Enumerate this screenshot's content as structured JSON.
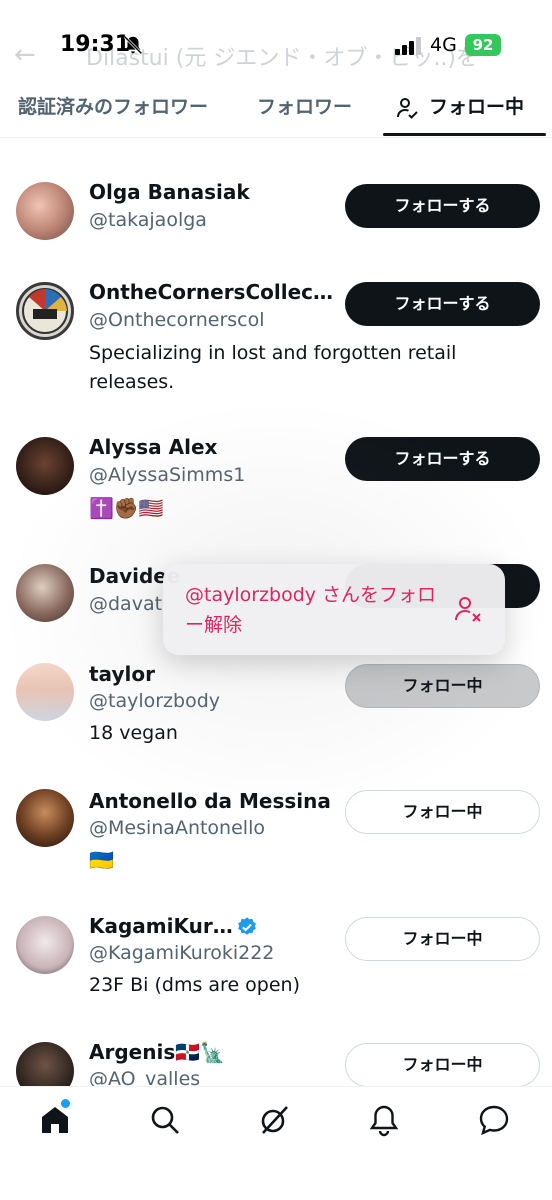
{
  "status": {
    "time": "19:31",
    "network": "4G",
    "battery": "92"
  },
  "header": {
    "back_ghost": "←",
    "title_ghost": "Dilastui (元 ジエンド・オブ・ピッ..)を"
  },
  "tabs": {
    "verified": "認証済みのフォロワー",
    "followers": "フォロワー",
    "following": "フォロー中"
  },
  "users": [
    {
      "name": "Olga Banasiak",
      "handle": "@takajaolga",
      "button": "フォローする"
    },
    {
      "name": "OntheCornersCollecti...",
      "handle": "@Onthecornerscol",
      "bio": "Specializing in lost and forgotten retail releases.",
      "button": "フォローする"
    },
    {
      "name": "Alyssa Alex",
      "handle": "@AlyssaSimms1",
      "bio": "✝️✊🏾🇺🇸",
      "button": "フォローする"
    },
    {
      "name": "Davidee",
      "handle": "@davat"
    },
    {
      "name": "taylor",
      "handle": "@taylorzbody",
      "bio": "18 vegan",
      "button": "フォロー中"
    },
    {
      "name": "Antonello da Messina",
      "handle": "@MesinaAntonello",
      "bio": "🇺🇦",
      "button": "フォロー中"
    },
    {
      "name": "KagamiKuroki",
      "handle": "@KagamiKuroki222",
      "bio": "23F Bi (dms are open)",
      "button": "フォロー中"
    },
    {
      "name": "Argenis🇩🇴🗽",
      "handle": "@AO_valles",
      "button": "フォロー中"
    }
  ],
  "context_menu": {
    "text": "@taylorzbody さんをフォロー解除"
  },
  "colors": {
    "accent": "#1d9bf0",
    "danger": "#e0245e",
    "ink": "#0f1419"
  }
}
